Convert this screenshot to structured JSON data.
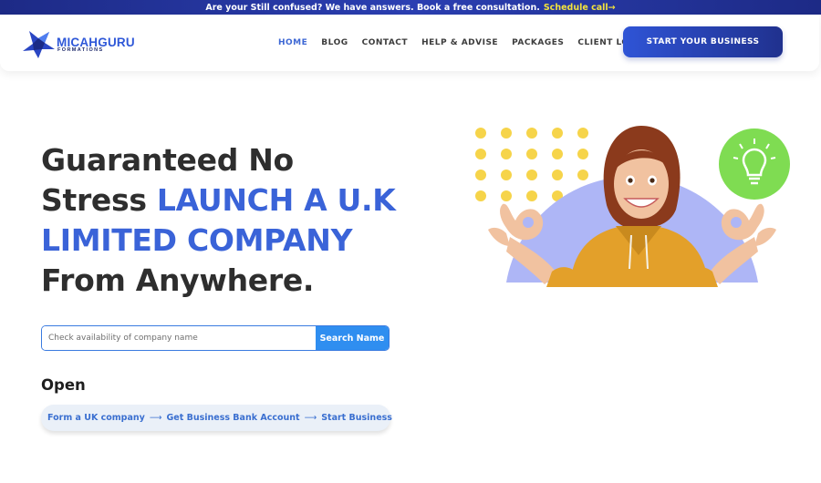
{
  "announcement": {
    "message": "Are your Still confused? We have answers. Book a free consultation.",
    "cta": "Schedule call→"
  },
  "brand": {
    "name": "MICAHGURU",
    "tagline": "FORMATIONS",
    "colors": {
      "primary": "#3a63d8",
      "navy": "#1f2a6b",
      "accent_yellow": "#f3e33c",
      "search_blue": "#2f8ef0"
    }
  },
  "nav": {
    "items": [
      {
        "label": "HOME",
        "active": true
      },
      {
        "label": "BLOG",
        "active": false
      },
      {
        "label": "CONTACT",
        "active": false
      },
      {
        "label": "HELP & ADVISE",
        "active": false
      },
      {
        "label": "PACKAGES",
        "active": false
      },
      {
        "label": "CLIENT LOGIN",
        "active": false
      }
    ],
    "cta": "START YOUR BUSINESS"
  },
  "hero": {
    "title_1": "Guaranteed No",
    "title_2": "Stress",
    "title_highlight_1": "LAUNCH A U.K",
    "title_highlight_2": "LIMITED COMPANY",
    "title_3": "From Anywhere."
  },
  "search": {
    "value": "",
    "placeholder": "Check availability of company name",
    "button": "Search Name"
  },
  "open": {
    "label": "Open",
    "steps": [
      "Form a UK company",
      "Get Business Bank Account",
      "Start Business"
    ]
  },
  "illustration": {
    "subject": "smiling woman in yellow hoodie making OK hand signs",
    "icons": [
      "lightbulb-icon",
      "dot-grid"
    ]
  }
}
